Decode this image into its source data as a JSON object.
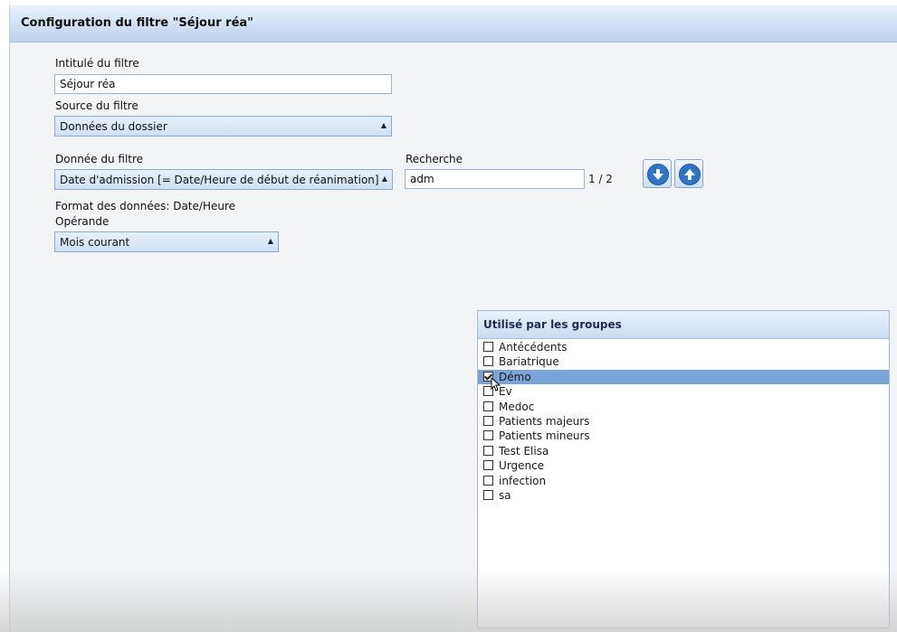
{
  "window": {
    "title": "Configuration du filtre \"Séjour réa\""
  },
  "form": {
    "intitule_label": "Intitulé du filtre",
    "intitule_value": "Séjour réa",
    "source_label": "Source du filtre",
    "source_value": "Données du dossier",
    "donnee_label": "Donnée du filtre",
    "donnee_value": "Date d'admission [= Date/Heure de début de réanimation]",
    "format_label": "Format des données: Date/Heure",
    "operande_label": "Opérande",
    "operande_value": "Mois courant"
  },
  "search": {
    "label": "Recherche",
    "value": "adm",
    "counter": "1 / 2"
  },
  "icons": {
    "next": "arrow-down-circle-icon",
    "previous": "arrow-up-circle-icon",
    "dropdown": "triangle-up-icon"
  },
  "groups": {
    "header": "Utilisé par les groupes",
    "items": [
      {
        "label": "Antécédents",
        "checked": false,
        "selected": false
      },
      {
        "label": "Bariatrique",
        "checked": false,
        "selected": false
      },
      {
        "label": "Démo",
        "checked": true,
        "selected": true
      },
      {
        "label": "Ev",
        "checked": false,
        "selected": false
      },
      {
        "label": "Medoc",
        "checked": false,
        "selected": false
      },
      {
        "label": "Patients majeurs",
        "checked": false,
        "selected": false
      },
      {
        "label": "Patients mineurs",
        "checked": false,
        "selected": false
      },
      {
        "label": "Test Elisa",
        "checked": false,
        "selected": false
      },
      {
        "label": "Urgence",
        "checked": false,
        "selected": false
      },
      {
        "label": "infection",
        "checked": false,
        "selected": false
      },
      {
        "label": "sa",
        "checked": false,
        "selected": false
      }
    ]
  },
  "colors": {
    "accent": "#2f74c6",
    "selection": "#7aa4d8",
    "header_text": "#1d2a54"
  }
}
